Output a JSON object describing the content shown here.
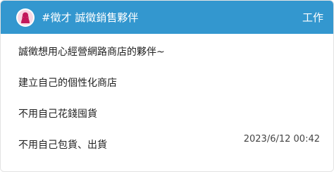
{
  "header": {
    "title": "#徵才 誠徵銷售夥伴",
    "tag": "工作"
  },
  "post": {
    "lines": [
      "誠徵想用心經營網路商店的夥伴~",
      "建立自己的個性化商店",
      "不用自己花錢囤貨",
      "不用自己包貨、出貨"
    ],
    "timestamp": "2023/6/12 00:42"
  },
  "colors": {
    "header_bg": "#3397cf",
    "avatar_icon": "#c2185b"
  },
  "icons": {
    "avatar": "female-profile-icon"
  }
}
